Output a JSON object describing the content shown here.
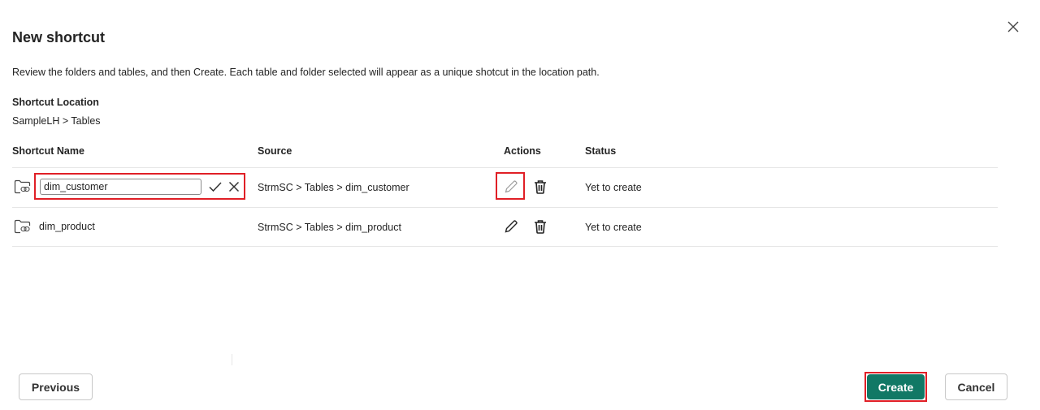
{
  "dialog": {
    "title": "New shortcut",
    "description": "Review the folders and tables, and then Create. Each table and folder selected will appear as a unique shotcut in the location path.",
    "location_label": "Shortcut Location",
    "location_path": "SampleLH > Tables"
  },
  "table": {
    "headers": {
      "name": "Shortcut Name",
      "source": "Source",
      "actions": "Actions",
      "status": "Status"
    },
    "rows": [
      {
        "name": "dim_customer",
        "source": "StrmSC > Tables > dim_customer",
        "status": "Yet to create",
        "editing": true
      },
      {
        "name": "dim_product",
        "source": "StrmSC > Tables > dim_product",
        "status": "Yet to create",
        "editing": false
      }
    ]
  },
  "footer": {
    "previous_label": "Previous",
    "create_label": "Create",
    "cancel_label": "Cancel"
  },
  "icons": {
    "close": "close-icon",
    "shortcut_folder": "folder-link-icon",
    "confirm": "checkmark-icon",
    "cancel_edit": "close-icon",
    "edit": "pencil-icon",
    "delete": "trash-icon"
  },
  "colors": {
    "primary": "#117865",
    "highlight": "#e01f26",
    "divider": "#e6e6e6"
  }
}
